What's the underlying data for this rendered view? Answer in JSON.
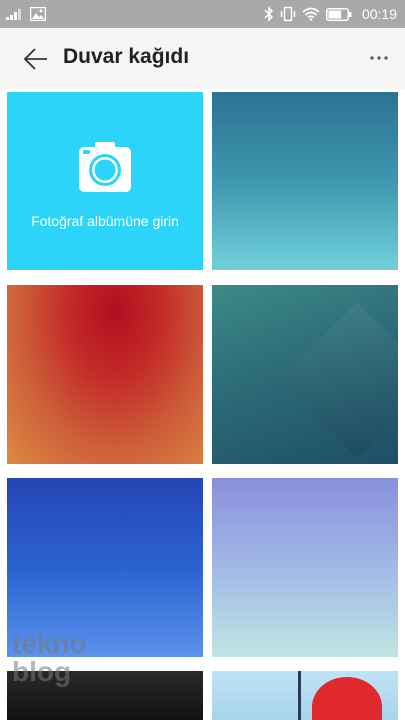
{
  "status_bar": {
    "time": "00:19",
    "icons": [
      "signal-icon",
      "image-notification-icon",
      "bluetooth-icon",
      "vibrate-icon",
      "wifi-icon",
      "battery-icon"
    ],
    "battery_level": 0.7
  },
  "app_bar": {
    "title": "Duvar kağıdı",
    "back_icon": "back-arrow-icon",
    "more_icon": "more-dots-icon"
  },
  "grid": {
    "camera_tile": {
      "label": "Fotoğraf albümüne girin",
      "icon": "camera-icon",
      "color": "#2dd4fa"
    },
    "wallpapers": [
      {
        "name": "teal-gradient"
      },
      {
        "name": "red-orange-gradient"
      },
      {
        "name": "dark-teal-geometric"
      },
      {
        "name": "blue-gradient"
      },
      {
        "name": "lavender-mint-gradient"
      },
      {
        "name": "black-leather"
      },
      {
        "name": "red-sailboat"
      }
    ]
  },
  "watermark": {
    "line1": "tekno",
    "line2": "blog"
  }
}
